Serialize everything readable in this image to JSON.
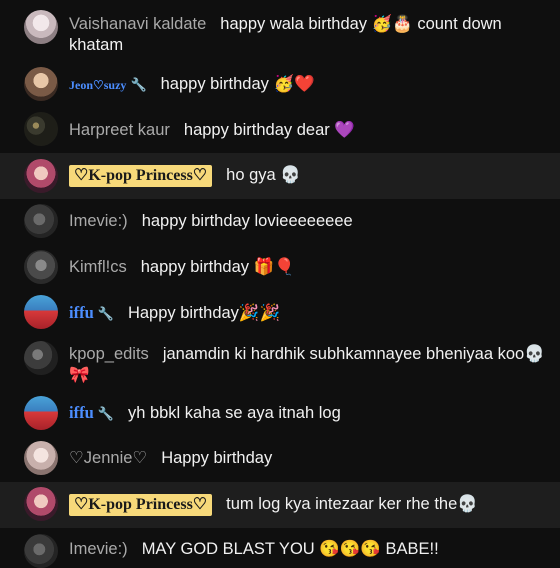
{
  "messages": [
    {
      "author": "Vaishanavi kaldate",
      "text": "happy wala birthday 🥳🎂 count down khatam"
    },
    {
      "author": "Jeon♡suzy",
      "text": "happy birthday 🥳❤️",
      "wrench": "🔧"
    },
    {
      "author": "Harpreet kaur",
      "text": "happy birthday dear 💜"
    },
    {
      "author": "♡K-pop Princess♡",
      "text": "ho gya 💀"
    },
    {
      "author": "Imevie:)",
      "text": "happy birthday lovieeeeeeee"
    },
    {
      "author": "Kimfl!cs",
      "text": "happy birthday 🎁🎈"
    },
    {
      "author": "iffu",
      "text": "Happy birthday🎉🎉",
      "wrench": "🔧"
    },
    {
      "author": "kpop_edits",
      "text": "janamdin ki hardhik subhkamnayee bheniyaa koo💀🎀"
    },
    {
      "author": "iffu",
      "text": "yh bbkl kaha se aya itnah log",
      "wrench": "🔧"
    },
    {
      "author": "♡Jennie♡",
      "text": "Happy birthday"
    },
    {
      "author": "♡K-pop Princess♡",
      "text": "tum log kya intezaar ker rhe the💀"
    },
    {
      "author": "Imevie:)",
      "text": "MAY GOD BLAST YOU 😘😘😘 BABE!!"
    }
  ]
}
